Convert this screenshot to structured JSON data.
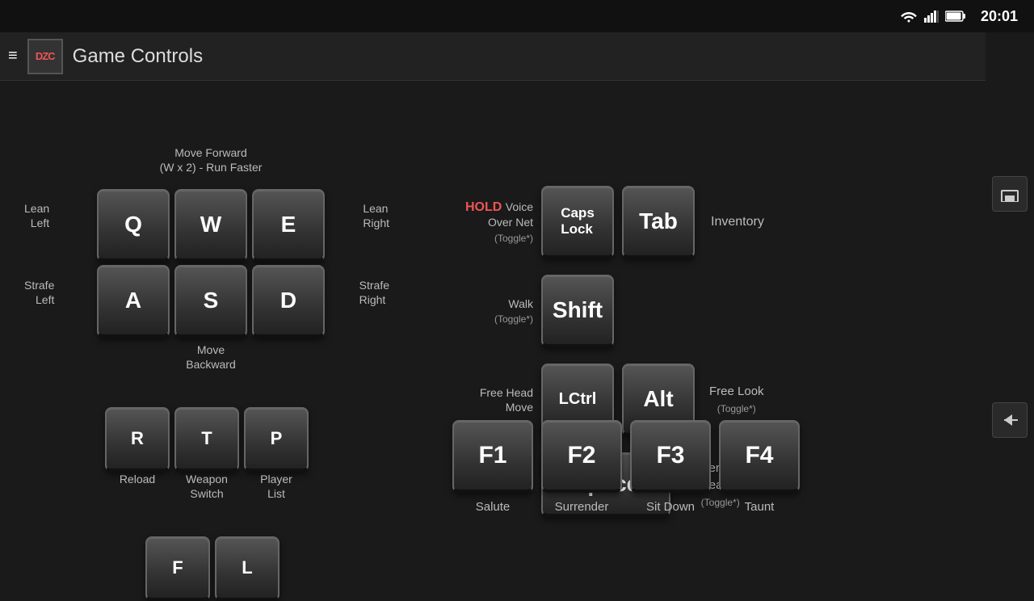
{
  "status_bar": {
    "time": "20:01"
  },
  "header": {
    "menu_label": "≡",
    "logo_text": "DZC",
    "title": "Game Controls"
  },
  "wasd": {
    "move_forward": "Move Forward",
    "run_faster": "(W x 2) - Run Faster",
    "lean_left": "Lean\nLeft",
    "lean_right": "Lean\nRight",
    "strafe_left": "Strafe\nLeft",
    "strafe_right": "Strafe\nRight",
    "move_backward": "Move\nBackward",
    "q": "Q",
    "w": "W",
    "e": "E",
    "a": "A",
    "s": "S",
    "d": "D"
  },
  "bottom_keys": {
    "r": "R",
    "t": "T",
    "p": "P",
    "reload": "Reload",
    "weapon_switch": "Weapon\nSwitch",
    "player_list": "Player\nList",
    "f": "F",
    "l": "L"
  },
  "right_controls": {
    "hold": "HOLD",
    "voice_over_net": "Voice\nOver Net",
    "toggle": "(Toggle*)",
    "caps_lock": "Caps\nLock",
    "tab": "Tab",
    "inventory": "Inventory",
    "walk": "Walk",
    "walk_toggle": "(Toggle*)",
    "shift": "Shift",
    "free_head_move": "Free Head\nMove",
    "lctrl": "LCtrl",
    "alt": "Alt",
    "free_look": "Free Look\n(Toggle*)",
    "space": "Space",
    "lower_raise": "Lower/Raise\nWeapon\n(Toggle*)",
    "f1": "F1",
    "f2": "F2",
    "f3": "F3",
    "f4": "F4",
    "salute": "Salute",
    "surrender": "Surrender",
    "sit_down": "Sit Down",
    "taunt": "Taunt"
  },
  "nav_buttons": {
    "home": "⌂",
    "back": "←"
  }
}
